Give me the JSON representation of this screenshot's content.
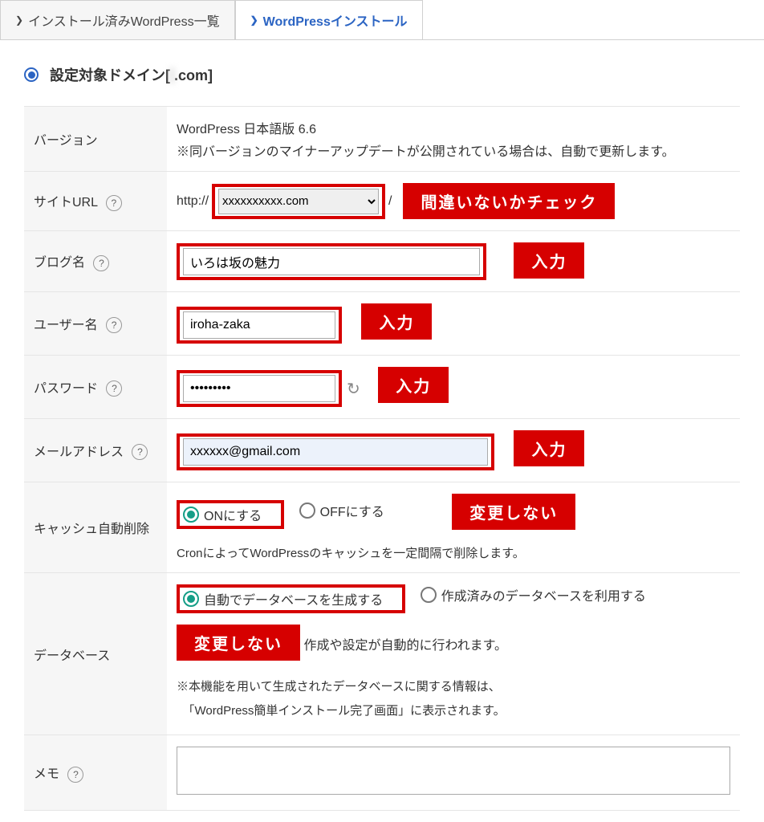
{
  "tabs": {
    "list": {
      "label": "インストール済みWordPress一覧",
      "marker": "❯"
    },
    "install": {
      "label": "WordPressインストール",
      "marker": "❯"
    }
  },
  "domain": {
    "label_prefix": "設定対象ドメイン[",
    "masked": "                    ",
    "suffix": ".com]"
  },
  "rows": {
    "version": {
      "th": "バージョン",
      "l1": "WordPress 日本語版 6.6",
      "l2": "※同バージョンのマイナーアップデートが公開されている場合は、自動で更新します。"
    },
    "siteurl": {
      "th": "サイトURL",
      "proto": "http://",
      "domain_suffix": ".com",
      "slash": " /",
      "callout": "間違いないかチェック"
    },
    "blogname": {
      "th": "ブログ名",
      "value": "いろは坂の魅力",
      "callout": "入力"
    },
    "username": {
      "th": "ユーザー名",
      "value": "iroha-zaka",
      "callout": "入力"
    },
    "password": {
      "th": "パスワード",
      "value": "●●●●●●●●●",
      "callout": "入力"
    },
    "email": {
      "th": "メールアドレス",
      "value": "xxxxxx@gmail.com",
      "callout": "入力"
    },
    "cache": {
      "th": "キャッシュ自動削除",
      "on": "ONにする",
      "off": "OFFにする",
      "callout": "変更しない",
      "note": "CronによってWordPressのキャッシュを一定間隔で削除します。"
    },
    "db": {
      "th": "データベース",
      "opt1": "自動でデータベースを生成する",
      "opt2": "作成済みのデータベースを利用する",
      "callout": "変更しない",
      "after_callout_tail": "作成や設定が自動的に行われます。",
      "note1": "※本機能を用いて生成されたデータベースに関する情報は、",
      "note2": "　「WordPress簡単インストール完了画面」に表示されます。"
    },
    "memo": {
      "th": "メモ",
      "value": ""
    }
  },
  "help_glyph": "?"
}
